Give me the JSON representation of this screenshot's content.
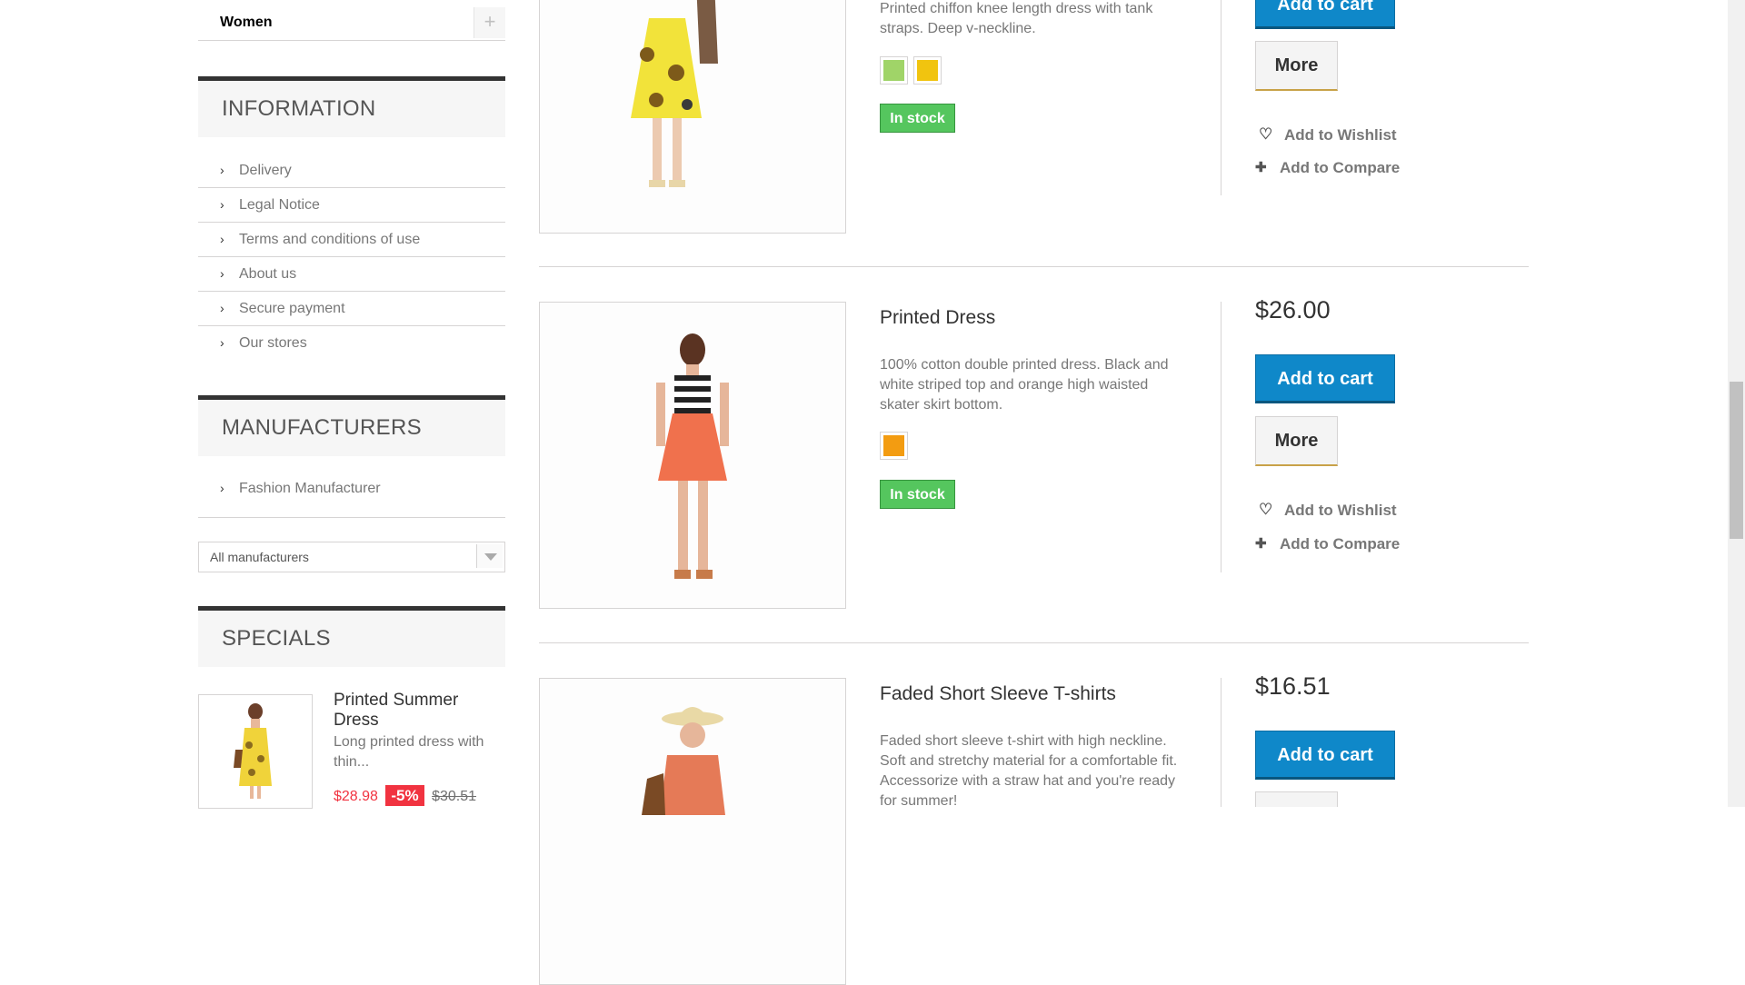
{
  "sidebar": {
    "category_women": "Women",
    "category_toggle": "+",
    "information": {
      "title": "INFORMATION",
      "items": [
        "Delivery",
        "Legal Notice",
        "Terms and conditions of use",
        "About us",
        "Secure payment",
        "Our stores"
      ]
    },
    "manufacturers": {
      "title": "MANUFACTURERS",
      "items": [
        "Fashion Manufacturer"
      ],
      "select_value": "All manufacturers"
    },
    "specials": {
      "title": "SPECIALS",
      "product_name": "Printed Summer Dress",
      "product_desc": "Long printed dress with thin...",
      "price_new": "$28.98",
      "discount": "-5%",
      "price_old": "$30.51"
    }
  },
  "products": [
    {
      "name": "",
      "desc": "Printed chiffon knee length dress with tank straps. Deep v-neckline.",
      "colors": [
        "#a0d468",
        "#f1c40f"
      ],
      "stock": "In stock",
      "price": "",
      "cart_label": "Add to cart",
      "more_label": "More",
      "wishlist_label": "Add to Wishlist",
      "compare_label": "Add to Compare"
    },
    {
      "name": "Printed Dress",
      "desc": "100% cotton double printed dress. Black and white striped top and orange high waisted skater skirt bottom.",
      "colors": [
        "#f39c11"
      ],
      "stock": "In stock",
      "price": "$26.00",
      "cart_label": "Add to cart",
      "more_label": "More",
      "wishlist_label": "Add to Wishlist",
      "compare_label": "Add to Compare"
    },
    {
      "name": "Faded Short Sleeve T-shirts",
      "desc": "Faded short sleeve t-shirt with high neckline. Soft and stretchy material for a comfortable fit. Accessorize with a straw hat and you're ready for summer!",
      "price": "$16.51",
      "cart_label": "Add to cart"
    }
  ],
  "icons": {
    "chevron": "›",
    "heart": "♡",
    "plus": "✚"
  }
}
